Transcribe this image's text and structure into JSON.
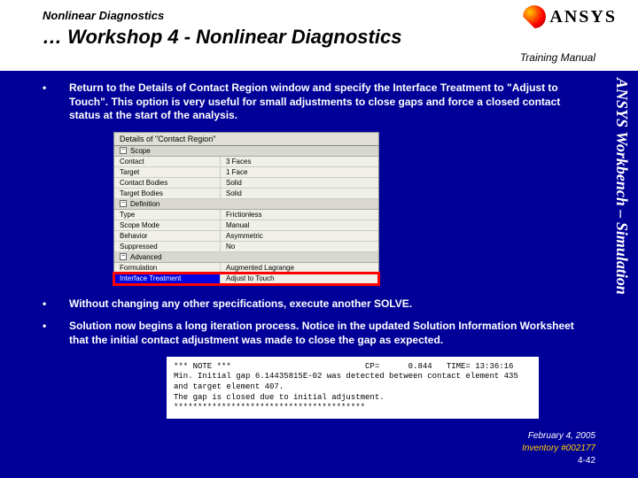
{
  "header": {
    "topic": "Nonlinear Diagnostics",
    "title": "… Workshop 4 - Nonlinear Diagnostics",
    "training_manual": "Training Manual",
    "logo_text": "ANSYS"
  },
  "vertical_label": "ANSYS Workbench – Simulation",
  "bullets": [
    "Return to the Details of Contact Region window and specify the Interface Treatment to \"Adjust to Touch\".  This option is very useful for small adjustments to close gaps and force a closed contact status at the start of the analysis.",
    "Without changing any other specifications, execute another SOLVE.",
    "Solution now begins a long iteration process.  Notice in the updated Solution Information Worksheet that the initial contact adjustment was made to close the gap as expected."
  ],
  "details_panel": {
    "title": "Details of \"Contact Region\"",
    "scope_header": "Scope",
    "scope_rows": [
      {
        "k": "Contact",
        "v": "3 Faces"
      },
      {
        "k": "Target",
        "v": "1 Face"
      },
      {
        "k": "Contact Bodies",
        "v": "Solid"
      },
      {
        "k": "Target Bodies",
        "v": "Solid"
      }
    ],
    "definition_header": "Definition",
    "definition_rows": [
      {
        "k": "Type",
        "v": "Frictionless"
      },
      {
        "k": "Scope Mode",
        "v": "Manual"
      },
      {
        "k": "Behavior",
        "v": "Asymmetric"
      },
      {
        "k": "Suppressed",
        "v": "No"
      }
    ],
    "advanced_header": "Advanced",
    "advanced_rows": [
      {
        "k": "Formulation",
        "v": "Augmented Lagrange"
      },
      {
        "k": "Interface Treatment",
        "v": "Adjust to Touch",
        "highlight": true
      }
    ]
  },
  "solver_output": "*** NOTE ***                            CP=      0.844   TIME= 13:36:16\nMin. Initial gap 6.14435815E-02 was detected between contact element 435\nand target element 407.\nThe gap is closed due to initial adjustment.\n****************************************",
  "footer": {
    "date": "February 4, 2005",
    "inventory": "Inventory #002177",
    "page": "4-42"
  }
}
